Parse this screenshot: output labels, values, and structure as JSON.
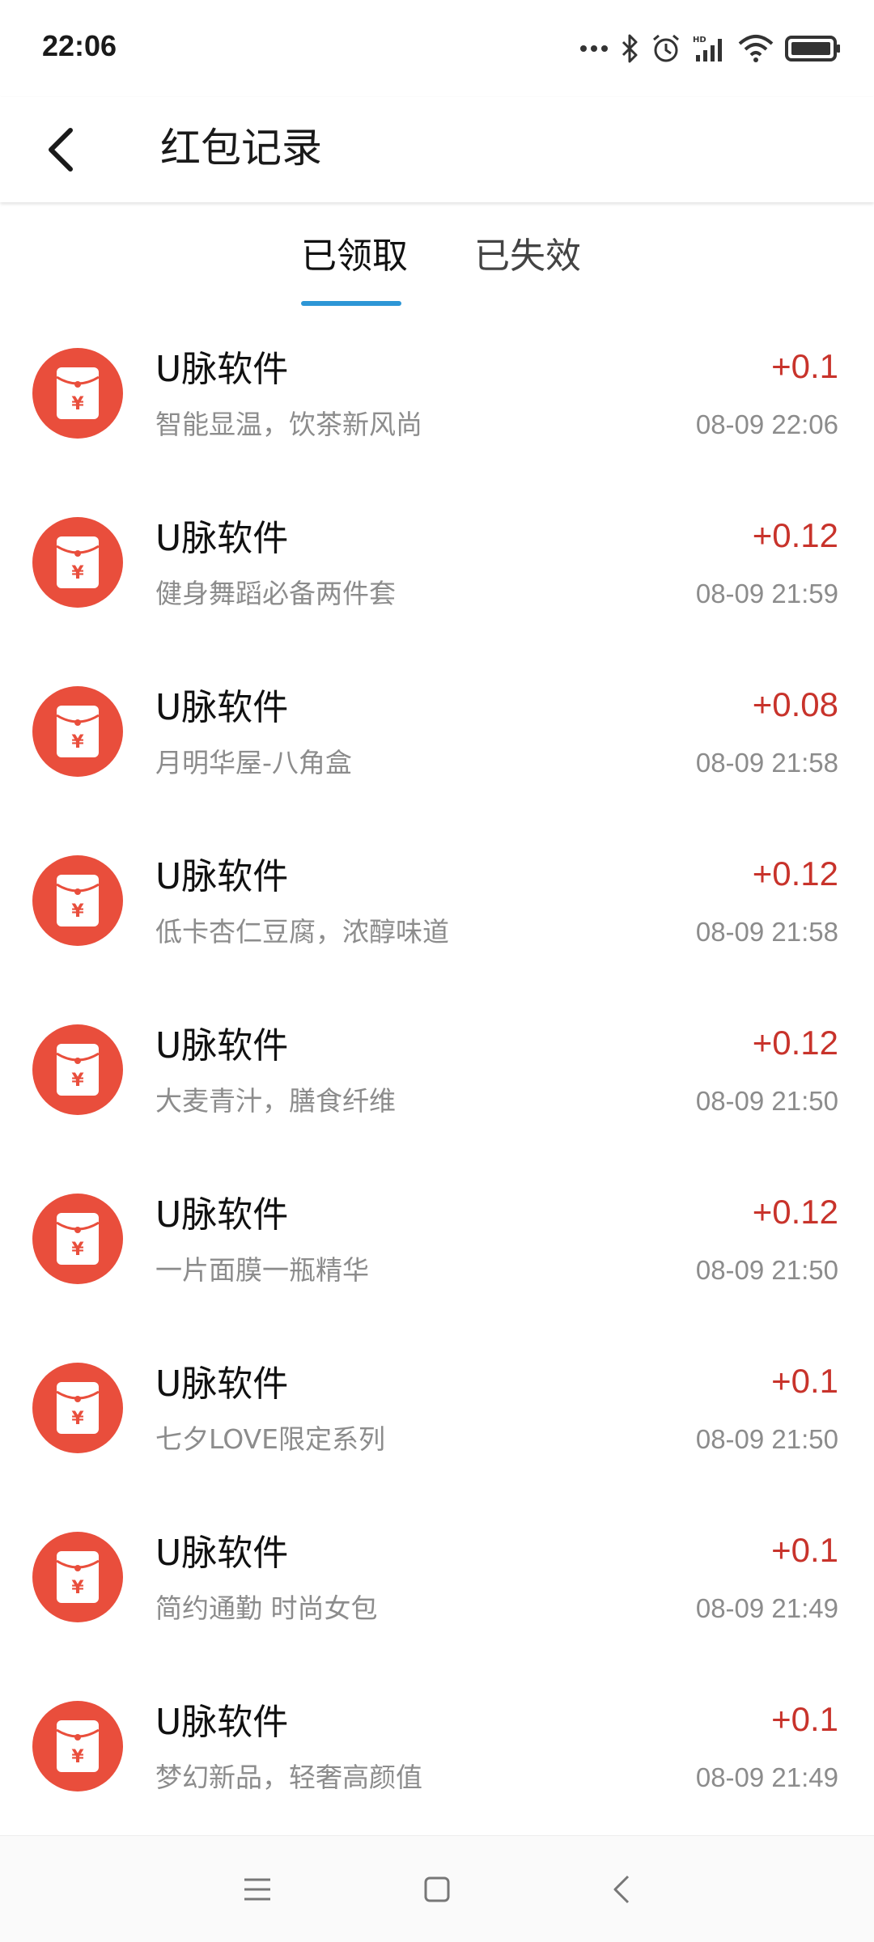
{
  "status_bar": {
    "time": "22:06",
    "icons": [
      "more-dots-icon",
      "bluetooth-icon",
      "alarm-icon",
      "hd-signal-icon",
      "wifi-icon",
      "battery-icon"
    ]
  },
  "header": {
    "title": "红包记录",
    "back_icon": "chevron-left-icon"
  },
  "tabs": [
    {
      "label": "已领取",
      "active": true
    },
    {
      "label": "已失效",
      "active": false
    }
  ],
  "colors": {
    "accent": "#2d96d6",
    "packet_red": "#e94e3c",
    "amount_red": "#c8332b",
    "secondary_text": "#8c8c8c"
  },
  "records": [
    {
      "name": "U脉软件",
      "desc": "智能显温，饮茶新风尚",
      "amount": "+0.1",
      "time": "08-09 22:06"
    },
    {
      "name": "U脉软件",
      "desc": "健身舞蹈必备两件套",
      "amount": "+0.12",
      "time": "08-09 21:59"
    },
    {
      "name": "U脉软件",
      "desc": "月明华屋-八角盒",
      "amount": "+0.08",
      "time": "08-09 21:58"
    },
    {
      "name": "U脉软件",
      "desc": "低卡杏仁豆腐，浓醇味道",
      "amount": "+0.12",
      "time": "08-09 21:58"
    },
    {
      "name": "U脉软件",
      "desc": "大麦青汁，膳食纤维",
      "amount": "+0.12",
      "time": "08-09 21:50"
    },
    {
      "name": "U脉软件",
      "desc": "一片面膜一瓶精华",
      "amount": "+0.12",
      "time": "08-09 21:50"
    },
    {
      "name": "U脉软件",
      "desc": "七夕LOVE限定系列",
      "amount": "+0.1",
      "time": "08-09 21:50"
    },
    {
      "name": "U脉软件",
      "desc": "简约通勤 时尚女包",
      "amount": "+0.1",
      "time": "08-09 21:49"
    },
    {
      "name": "U脉软件",
      "desc": "梦幻新品，轻奢高颜值",
      "amount": "+0.1",
      "time": "08-09 21:49"
    }
  ],
  "nav_bar": {
    "icons": [
      "menu-icon",
      "home-square-icon",
      "back-triangle-icon"
    ]
  }
}
